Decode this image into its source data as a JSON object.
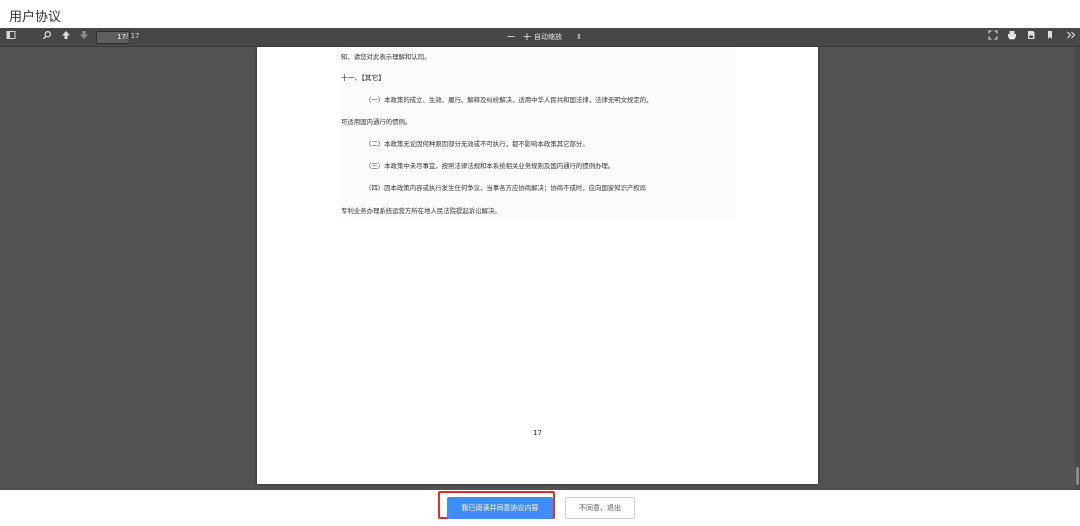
{
  "dialog": {
    "title": "用户协议"
  },
  "toolbar": {
    "sidebar_icon": "sidebar-toggle-icon",
    "search_icon": "search-icon",
    "prev_icon": "arrow-up-icon",
    "next_icon": "arrow-down-icon",
    "current_page": "17",
    "total_pages": "/ 17",
    "zoom_out": "−",
    "zoom_in": "+",
    "zoom_value": "自动缩放",
    "zoom_arrow": "⇕",
    "fullscreen_icon": "fullscreen-icon",
    "print_icon": "print-icon",
    "download_icon": "save-icon",
    "bookmark_icon": "bookmark-icon",
    "more_icon": "more-tools-icon"
  },
  "document": {
    "lines": [
      "知，请您对此表示理解和认同。",
      "十一、【其它】",
      "（一）本政策的成立、生效、履行、解释及纠纷解决，适用中华人民共和国法律，法律无明文规定的，",
      "可适用国内通行的惯例。",
      "（二）本政策无论因何种原因部分无效或不可执行，都不影响本政策其它部分。",
      "（三）本政策中未尽事宜，按照法律法规和本系统相关业务规则及国内通行的惯例办理。",
      "（四）因本政策内容或执行发生任何争议，当事各方应协商解决；协商不成时，应向国家知识产权局",
      "专利业务办理系统运营方所在地人民法院提起诉讼解决。"
    ],
    "page_number": "17"
  },
  "footer": {
    "agree_label": "我已阅读并同意协议内容",
    "decline_label": "不同意，退出"
  },
  "colors": {
    "toolbar": "#474747",
    "viewer_bg": "#525252",
    "primary_button": "#3d8ef8",
    "highlight": "#e32d2d"
  }
}
